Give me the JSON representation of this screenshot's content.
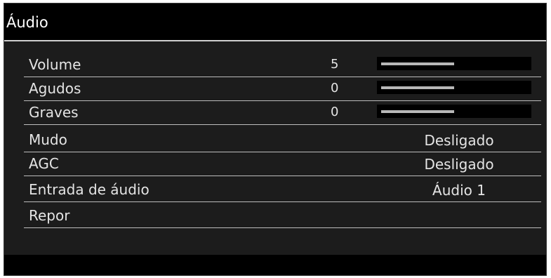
{
  "window": {
    "title": "Áudio"
  },
  "menu": {
    "volume": {
      "label": "Volume",
      "value": "5",
      "level": 0.5
    },
    "treble": {
      "label": "Agudos",
      "value": "0",
      "level": 0.5
    },
    "bass": {
      "label": "Graves",
      "value": "0",
      "level": 0.5
    },
    "mute": {
      "label": "Mudo",
      "value": "Desligado"
    },
    "agc": {
      "label": "AGC",
      "value": "Desligado"
    },
    "audio_input": {
      "label": "Entrada de áudio",
      "value": "Áudio 1"
    },
    "reset": {
      "label": "Repor"
    }
  },
  "colors": {
    "background": "#1c1c1c",
    "title_bar": "#000000",
    "text": "#e4e4e4",
    "slider_fill": "#b8b8b8",
    "slider_track": "#000000"
  }
}
